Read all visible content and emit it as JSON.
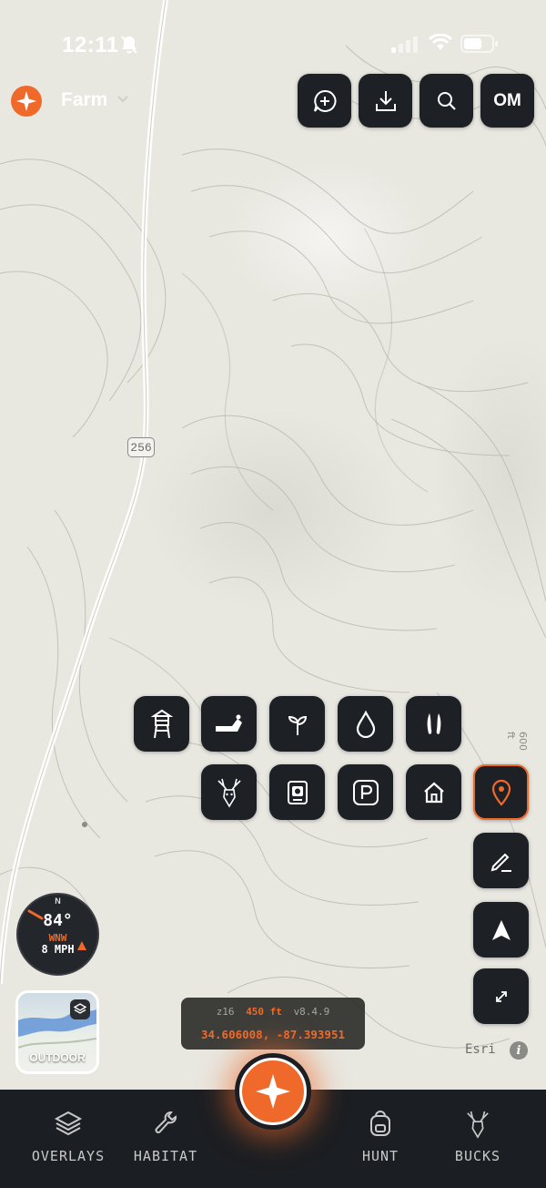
{
  "status_bar": {
    "time": "12:11"
  },
  "header": {
    "map_name": "Farm",
    "account_initials": "OM"
  },
  "map": {
    "road_label": "256",
    "elevation_label": "600 ft",
    "attribution": "Esri"
  },
  "markers": [
    {
      "name": "stand-icon"
    },
    {
      "name": "blind-icon"
    },
    {
      "name": "food-plot-icon"
    },
    {
      "name": "water-icon"
    },
    {
      "name": "tracks-icon"
    },
    {
      "name": "buck-icon"
    },
    {
      "name": "camera-icon"
    },
    {
      "name": "parking-icon"
    },
    {
      "name": "home-icon"
    }
  ],
  "wind": {
    "north": "N",
    "temperature": "84°",
    "direction": "WNW",
    "speed": "8 MPH"
  },
  "layers": {
    "label": "OUTDOOR"
  },
  "map_info": {
    "zoom": "z16",
    "elevation": "450 ft",
    "version": "v8.4.9",
    "coordinates": "34.606008, -87.393951"
  },
  "colors": {
    "accent": "#ef6a2a",
    "panel": "#1d2024",
    "nav": "#1b1e22"
  },
  "bottom_nav": {
    "overlays": "OVERLAYS",
    "habitat": "HABITAT",
    "hunt": "HUNT",
    "bucks": "BUCKS"
  }
}
